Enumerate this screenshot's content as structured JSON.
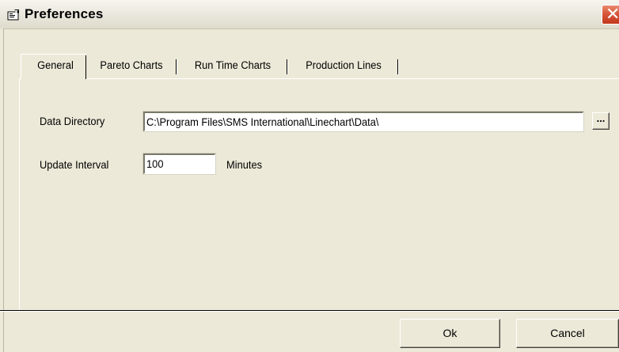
{
  "window": {
    "title": "Preferences",
    "icon": "preferences-icon",
    "close_glyph": "✕"
  },
  "tabs": [
    {
      "label": "General",
      "active": true
    },
    {
      "label": "Pareto Charts",
      "active": false
    },
    {
      "label": "Run Time Charts",
      "active": false
    },
    {
      "label": "Production Lines",
      "active": false
    }
  ],
  "general": {
    "data_directory_label": "Data Directory",
    "data_directory_value": "C:\\Program Files\\SMS International\\Linechart\\Data\\",
    "browse_label": "...",
    "update_interval_label": "Update Interval",
    "update_interval_value": "100",
    "update_interval_unit": "Minutes"
  },
  "buttons": {
    "ok": "Ok",
    "cancel": "Cancel"
  },
  "colors": {
    "window_bg": "#ece9d8",
    "close_button": "#d8573b"
  }
}
